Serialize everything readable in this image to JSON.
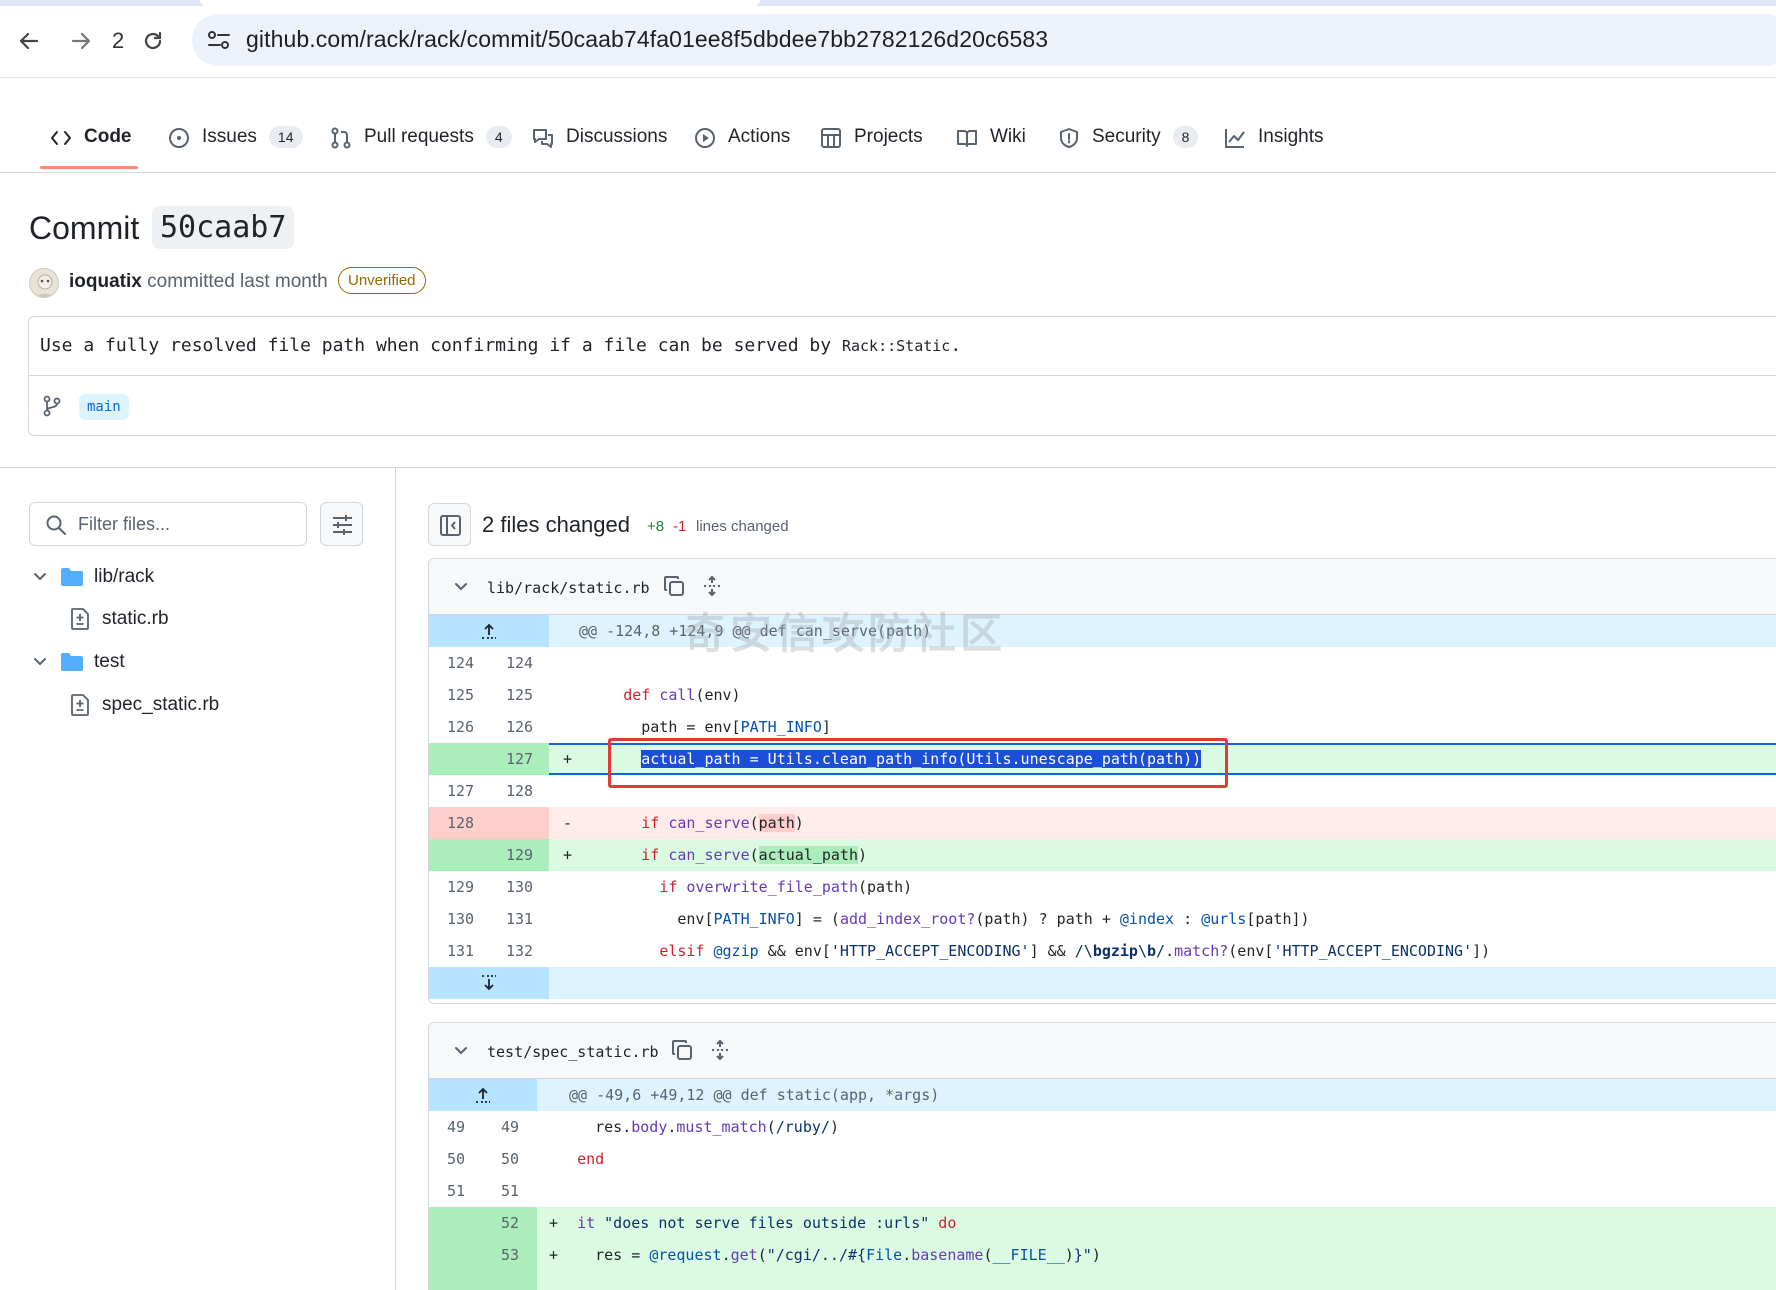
{
  "browser": {
    "url": "github.com/rack/rack/commit/50caab74fa01ee8f5dbdee7bb2782126d20c6583",
    "forward_count": "2"
  },
  "repo_nav": {
    "tabs": [
      {
        "label": "Code",
        "icon": "code-icon",
        "count": ""
      },
      {
        "label": "Issues",
        "icon": "issue-icon",
        "count": "14"
      },
      {
        "label": "Pull requests",
        "icon": "pull-request-icon",
        "count": "4"
      },
      {
        "label": "Discussions",
        "icon": "discussion-icon",
        "count": ""
      },
      {
        "label": "Actions",
        "icon": "play-icon",
        "count": ""
      },
      {
        "label": "Projects",
        "icon": "table-icon",
        "count": ""
      },
      {
        "label": "Wiki",
        "icon": "book-icon",
        "count": ""
      },
      {
        "label": "Security",
        "icon": "shield-icon",
        "count": "8"
      },
      {
        "label": "Insights",
        "icon": "graph-icon",
        "count": ""
      }
    ]
  },
  "commit": {
    "title": "Commit",
    "sha": "50caab7",
    "author": "ioquatix",
    "meta": "committed last month",
    "badge": "Unverified",
    "message": "Use a fully resolved file path when confirming if a file can be served by",
    "message_code": "Rack::Static",
    "message_end": ".",
    "branch": "main"
  },
  "sidebar": {
    "filter_placeholder": "Filter files...",
    "tree": [
      {
        "label": "lib/rack",
        "type": "folder"
      },
      {
        "label": "static.rb",
        "type": "file"
      },
      {
        "label": "test",
        "type": "folder"
      },
      {
        "label": "spec_static.rb",
        "type": "file"
      }
    ]
  },
  "summary": {
    "files_changed": "2 files changed",
    "additions": "+8",
    "deletions": "-1",
    "lines_label": "lines changed"
  },
  "files": [
    {
      "name": "lib/rack/static.rb",
      "hunk": "@@ -124,8 +124,9 @@ def can_serve(path)",
      "lines": [
        {
          "old": "124",
          "new": "124",
          "sign": "",
          "code": ""
        },
        {
          "old": "125",
          "new": "125",
          "sign": "",
          "code": "      def call(env)"
        },
        {
          "old": "126",
          "new": "126",
          "sign": "",
          "code": "        path = env[PATH_INFO]"
        },
        {
          "old": "",
          "new": "127",
          "sign": "+",
          "code": "        actual_path = Utils.clean_path_info(Utils.unescape_path(path))"
        },
        {
          "old": "127",
          "new": "128",
          "sign": "",
          "code": ""
        },
        {
          "old": "128",
          "new": "",
          "sign": "-",
          "code": "        if can_serve(path)"
        },
        {
          "old": "",
          "new": "129",
          "sign": "+",
          "code": "        if can_serve(actual_path)"
        },
        {
          "old": "129",
          "new": "130",
          "sign": "",
          "code": "          if overwrite_file_path(path)"
        },
        {
          "old": "130",
          "new": "131",
          "sign": "",
          "code": "            env[PATH_INFO] = (add_index_root?(path) ? path + @index : @urls[path])"
        },
        {
          "old": "131",
          "new": "132",
          "sign": "",
          "code": "          elsif @gzip && env['HTTP_ACCEPT_ENCODING'] && /\\bgzip\\b/.match?(env['HTTP_ACCEPT_ENCODING'])"
        }
      ]
    },
    {
      "name": "test/spec_static.rb",
      "hunk": "@@ -49,6 +49,12 @@ def static(app, *args)",
      "lines": [
        {
          "old": "49",
          "new": "49",
          "sign": "",
          "code": "    res.body.must_match(/ruby/)"
        },
        {
          "old": "50",
          "new": "50",
          "sign": "",
          "code": "  end"
        },
        {
          "old": "51",
          "new": "51",
          "sign": "",
          "code": ""
        },
        {
          "old": "",
          "new": "52",
          "sign": "+",
          "code": "  it \"does not serve files outside :urls\" do"
        },
        {
          "old": "",
          "new": "53",
          "sign": "+",
          "code": "    res = @request.get(\"/cgi/../#{File.basename(__FILE__)}\")"
        }
      ]
    }
  ],
  "watermark": "奇安信攻防社区",
  "colors": {
    "add_bg": "#dafbe1",
    "del_bg": "#ffebe9",
    "hunk_bg": "#ddf4ff",
    "accent": "#fd8c73"
  }
}
